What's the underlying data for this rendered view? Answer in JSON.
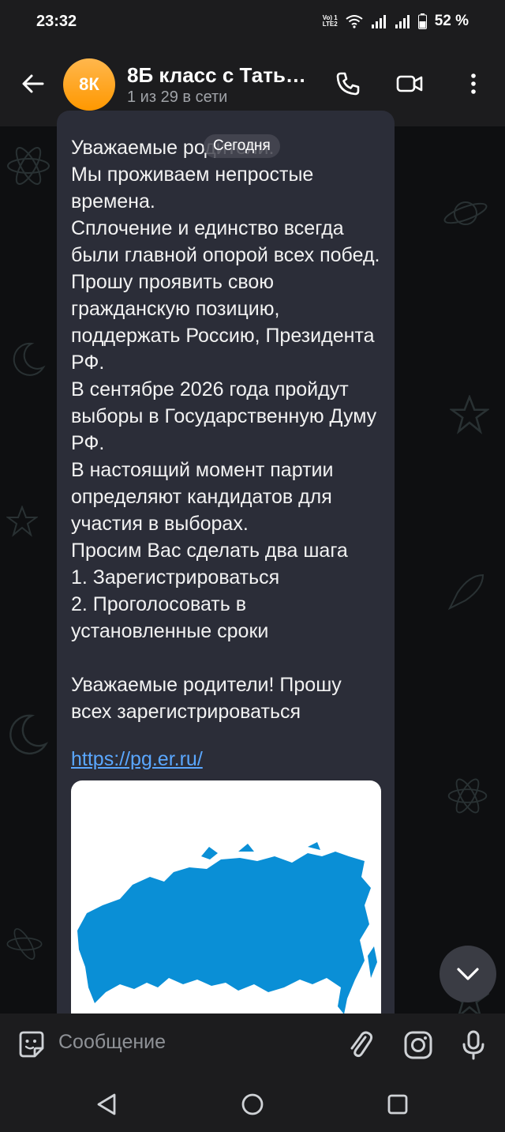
{
  "status": {
    "time": "23:32",
    "volte_top": "Vo) 1",
    "volte_bottom": "LTE2",
    "battery": "52 %"
  },
  "header": {
    "avatar_initials": "8К",
    "title": "8Б класс с Тать…",
    "subtitle": "1 из 29 в сети"
  },
  "chat": {
    "date_label": "Сегодня",
    "message_text": "Уважаемые родители.\nМы проживаем непростые времена.\nСплочение и единство всегда были главной опорой всех побед.\nПрошу проявить свою гражданскую позицию, поддержать Россию, Президента РФ.\nВ сентябре 2026 года пройдут выборы в Государственную Думу РФ.\nВ настоящий момент партии определяют кандидатов для участия в выборах.\nПросим Вас сделать два шага\n1. Зарегистрироваться\n2. Проголосовать в установленные сроки\n\nУважаемые родители! Прошу всех зарегистрироваться",
    "link": "https://pg.er.ru/"
  },
  "composer": {
    "placeholder": "Сообщение"
  },
  "colors": {
    "accent_link": "#5aa7ff",
    "bubble": "#2b2d38",
    "map_blue": "#0a8fd6",
    "avatar": "#ff9800"
  }
}
